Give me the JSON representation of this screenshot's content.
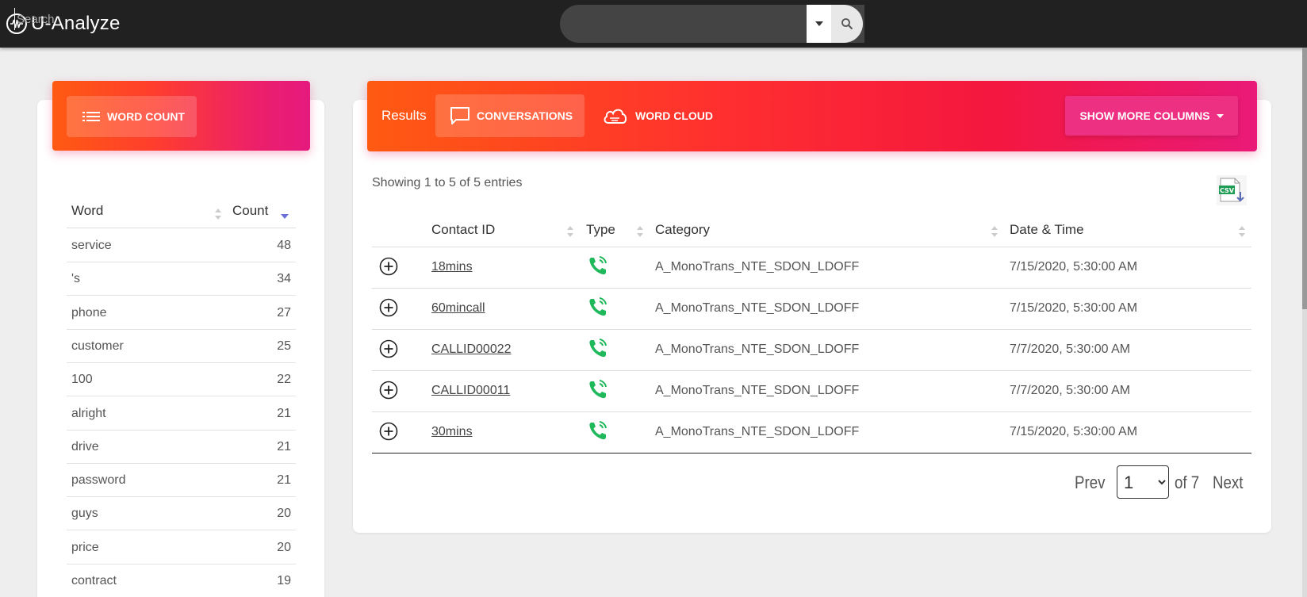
{
  "app": {
    "title": "U-Analyze"
  },
  "search": {
    "placeholder": "Search"
  },
  "word_panel": {
    "button_label": "WORD COUNT",
    "columns": {
      "word": "Word",
      "count": "Count"
    },
    "rows": [
      {
        "word": "service",
        "count": "48"
      },
      {
        "word": "'s",
        "count": "34"
      },
      {
        "word": "phone",
        "count": "27"
      },
      {
        "word": "customer",
        "count": "25"
      },
      {
        "word": "100",
        "count": "22"
      },
      {
        "word": "alright",
        "count": "21"
      },
      {
        "word": "drive",
        "count": "21"
      },
      {
        "word": "password",
        "count": "21"
      },
      {
        "word": "guys",
        "count": "20"
      },
      {
        "word": "price",
        "count": "20"
      },
      {
        "word": "contract",
        "count": "19"
      }
    ]
  },
  "results_panel": {
    "label": "Results",
    "tabs": {
      "conversations": "CONVERSATIONS",
      "word_cloud": "WORD CLOUD"
    },
    "more_columns": "SHOW MORE COLUMNS",
    "showing": "Showing 1 to 5 of 5 entries",
    "columns": {
      "contact_id": "Contact ID",
      "type": "Type",
      "category": "Category",
      "datetime": "Date & Time"
    },
    "rows": [
      {
        "contact_id": "18mins",
        "type_icon": "phone-call-icon",
        "category": "A_MonoTrans_NTE_SDON_LDOFF",
        "datetime": "7/15/2020, 5:30:00 AM"
      },
      {
        "contact_id": "60mincall",
        "type_icon": "phone-call-icon",
        "category": "A_MonoTrans_NTE_SDON_LDOFF",
        "datetime": "7/15/2020, 5:30:00 AM"
      },
      {
        "contact_id": "CALLID00022",
        "type_icon": "phone-call-icon",
        "category": "A_MonoTrans_NTE_SDON_LDOFF",
        "datetime": "7/7/2020, 5:30:00 AM"
      },
      {
        "contact_id": "CALLID00011",
        "type_icon": "phone-call-icon",
        "category": "A_MonoTrans_NTE_SDON_LDOFF",
        "datetime": "7/7/2020, 5:30:00 AM"
      },
      {
        "contact_id": "30mins",
        "type_icon": "phone-call-icon",
        "category": "A_MonoTrans_NTE_SDON_LDOFF",
        "datetime": "7/15/2020, 5:30:00 AM"
      }
    ]
  },
  "pagination": {
    "prev": "Prev",
    "current": "1",
    "of": "of 7",
    "next": "Next"
  },
  "colors": {
    "topbar": "#212121",
    "gradient_start": "#ff5a12",
    "gradient_end": "#e51a7e",
    "call_icon": "#1fb85a"
  }
}
